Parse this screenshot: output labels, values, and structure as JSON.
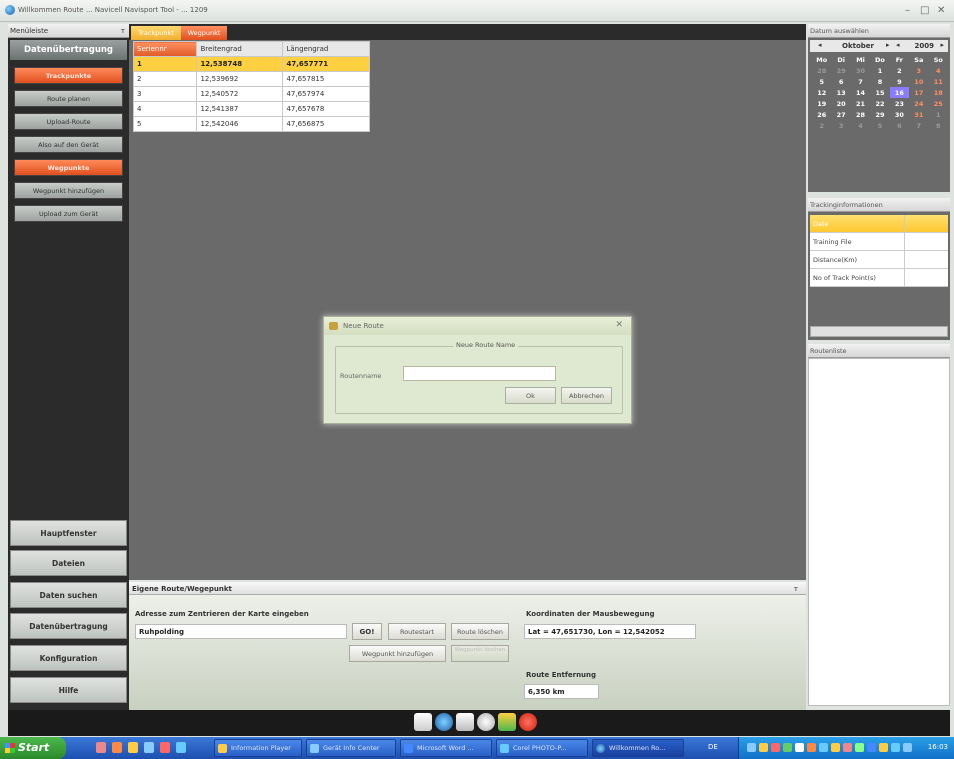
{
  "window": {
    "title": "Willkommen Route ... Navicell Navisport Tool - ... 1209",
    "minimize": "–",
    "maximize": "□",
    "close": "✕"
  },
  "left_panel": {
    "header": "Menüleiste",
    "pin": "ᴛ",
    "section_title": "Datenübertragung",
    "buttons": [
      "Trackpunkte",
      "Route planen",
      "Upload-Route",
      "Also auf den Gerät",
      "Wegpunkte",
      "Wegpunkt hinzufügen",
      "Upload zum Gerät"
    ],
    "nav": [
      "Hauptfenster",
      "Dateien",
      "Daten suchen",
      "Datenübertragung",
      "Konfiguration",
      "Hilfe"
    ]
  },
  "tabs": [
    "Trackpunkt",
    "Wegpunkt"
  ],
  "waypoint_table": {
    "headers": [
      "Seriennr",
      "Breitengrad",
      "Längengrad"
    ],
    "rows": [
      [
        "1",
        "12,538748",
        "47,657771"
      ],
      [
        "2",
        "12,539692",
        "47,657815"
      ],
      [
        "3",
        "12,540572",
        "47,657974"
      ],
      [
        "4",
        "12,541387",
        "47,657678"
      ],
      [
        "5",
        "12,542046",
        "47,656875"
      ]
    ]
  },
  "dialog": {
    "title": "Neue Route",
    "close": "✕",
    "group_label": "Neue Route Name",
    "field_label": "Routenname",
    "field_value": "",
    "ok": "Ok",
    "cancel": "Abbrechen"
  },
  "calendar": {
    "header": "Datum auswählen",
    "month": "Oktober",
    "year": "2009",
    "nav_prev": "◂",
    "nav_next": "▸",
    "nav_y_prev": "◂",
    "nav_y_next": "▸",
    "weekdays": [
      "Mo",
      "Di",
      "Mi",
      "Do",
      "Fr",
      "Sa",
      "So"
    ],
    "weeks": [
      [
        "28",
        "29",
        "30",
        "1",
        "2",
        "3",
        "4"
      ],
      [
        "5",
        "6",
        "7",
        "8",
        "9",
        "10",
        "11"
      ],
      [
        "12",
        "13",
        "14",
        "15",
        "16",
        "17",
        "18"
      ],
      [
        "19",
        "20",
        "21",
        "22",
        "23",
        "24",
        "25"
      ],
      [
        "26",
        "27",
        "28",
        "29",
        "30",
        "31",
        "1"
      ],
      [
        "2",
        "3",
        "4",
        "5",
        "6",
        "7",
        "8"
      ]
    ],
    "today": "16"
  },
  "tracking": {
    "header": "Trackinginformationen",
    "rows": [
      "Date",
      "Training File",
      "Distance(Km)",
      "No of Track Point(s)"
    ]
  },
  "route_list": {
    "header": "Routenliste"
  },
  "bottom_panel": {
    "header": "Eigene Route/Wegepunkt",
    "pin": "ᴛ",
    "address_label": "Adresse zum Zentrieren der Karte eingeben",
    "address_value": "Ruhpolding",
    "go": "GO!",
    "btn_routestart": "Routestart",
    "btn_route_loeschen": "Route löschen",
    "btn_wegpunkt_hinzufuegen": "Wegpunkt hinzufügen",
    "btn_disabled": "Wegpunkt löschen",
    "coord_label": "Koordinaten der Mausbewegung",
    "coord_value": "Lat = 47,651730, Lon = 12,542052",
    "distance_label": "Route Entfernung",
    "distance_value": "6,350 km"
  },
  "taskbar": {
    "start": "Start",
    "tasks": [
      "Information Player",
      "Gerät Info Center",
      "Microsoft Word ...",
      "Corel PHOTO-P...",
      "Willkommen Ro..."
    ],
    "lang": "DE",
    "clock": "16:03"
  },
  "colors": {
    "accent_orange": "#e05020",
    "selection_yellow": "#ffd040",
    "today": "#8a7cff"
  }
}
